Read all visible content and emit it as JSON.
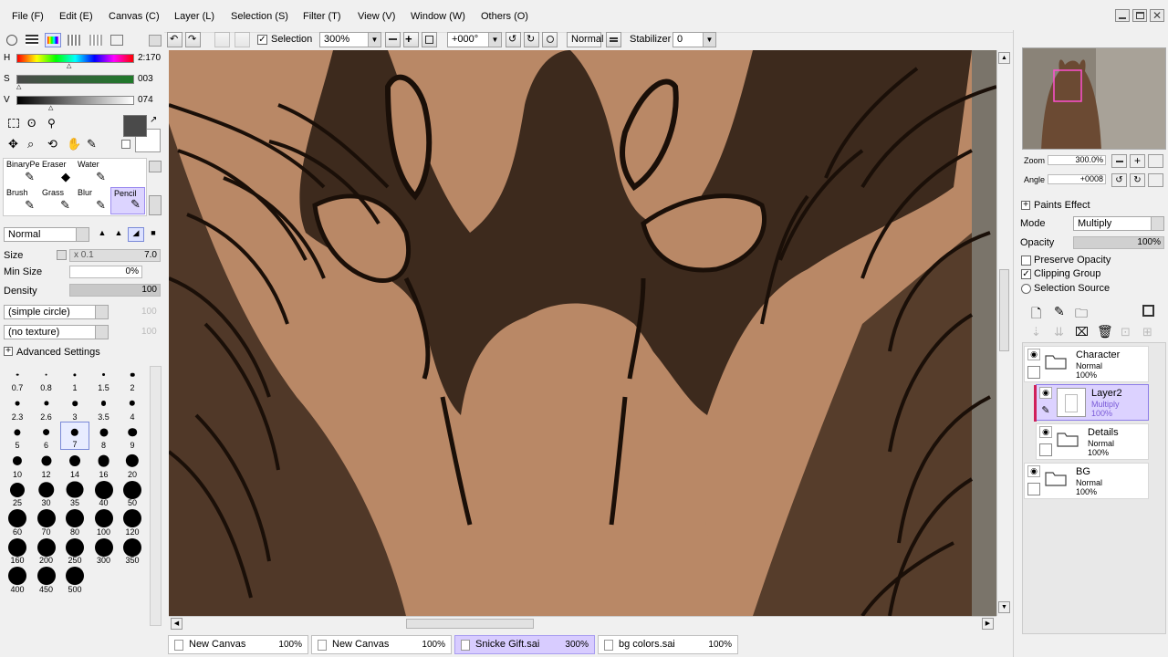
{
  "menu": [
    "File (F)",
    "Edit (E)",
    "Canvas (C)",
    "Layer (L)",
    "Selection (S)",
    "Filter (T)",
    "View (V)",
    "Window (W)",
    "Others (O)"
  ],
  "toolbar": {
    "selection_label": "Selection",
    "zoom_value": "300%",
    "rotation_value": "+000°",
    "blend_value": "Normal",
    "stabilizer_label": "Stabilizer",
    "stabilizer_value": "0"
  },
  "color": {
    "h_label": "H",
    "h_value": "2:170",
    "s_label": "S",
    "s_value": "003",
    "v_label": "V",
    "v_value": "074",
    "primary": "#4a4a4a",
    "secondary": "#ffffff"
  },
  "tools": [
    {
      "label": "BinaryPe",
      "glyph": "✎",
      "selected": false
    },
    {
      "label": "Eraser",
      "glyph": "◆",
      "selected": false
    },
    {
      "label": "Water",
      "glyph": "✎",
      "selected": false
    },
    {
      "label": "",
      "glyph": "",
      "selected": false
    },
    {
      "label": "Brush",
      "glyph": "✎",
      "selected": false
    },
    {
      "label": "Grass",
      "glyph": "✎",
      "selected": false
    },
    {
      "label": "Blur",
      "glyph": "✎",
      "selected": false
    },
    {
      "label": "Pencil",
      "glyph": "✎",
      "selected": true
    }
  ],
  "brush": {
    "blend": "Normal",
    "size_label": "Size",
    "size_mult": "x 0.1",
    "size_value": "7.0",
    "minsize_label": "Min Size",
    "minsize_value": "0%",
    "density_label": "Density",
    "density_value": "100",
    "shape": "(simple circle)",
    "shape_value": "100",
    "texture": "(no texture)",
    "texture_value": "100",
    "advanced_label": "Advanced Settings"
  },
  "brush_sizes": [
    "0.7",
    "0.8",
    "1",
    "1.5",
    "2",
    "2.3",
    "2.6",
    "3",
    "3.5",
    "4",
    "5",
    "6",
    "7",
    "8",
    "9",
    "10",
    "12",
    "14",
    "16",
    "20",
    "25",
    "30",
    "35",
    "40",
    "50",
    "60",
    "70",
    "80",
    "100",
    "120",
    "160",
    "200",
    "250",
    "300",
    "350",
    "400",
    "450",
    "500"
  ],
  "brush_size_selected": "7",
  "navigator": {
    "zoom_label": "Zoom",
    "zoom_value": "300.0%",
    "angle_label": "Angle",
    "angle_value": "+0008"
  },
  "layer_props": {
    "effect_label": "Paints Effect",
    "mode_label": "Mode",
    "mode_value": "Multiply",
    "opacity_label": "Opacity",
    "opacity_value": "100%",
    "preserve_label": "Preserve Opacity",
    "preserve_checked": false,
    "clipping_label": "Clipping Group",
    "clipping_checked": true,
    "selsource_label": "Selection Source"
  },
  "layers": [
    {
      "name": "Character",
      "mode": "Normal",
      "opacity": "100%",
      "type": "folder",
      "selected": false
    },
    {
      "name": "Layer2",
      "mode": "Multiply",
      "opacity": "100%",
      "type": "layer",
      "selected": true
    },
    {
      "name": "Details",
      "mode": "Normal",
      "opacity": "100%",
      "type": "folder",
      "selected": false
    },
    {
      "name": "BG",
      "mode": "Normal",
      "opacity": "100%",
      "type": "folder",
      "selected": false
    }
  ],
  "tabs": [
    {
      "name": "New Canvas",
      "percent": "100%",
      "active": false
    },
    {
      "name": "New Canvas",
      "percent": "100%",
      "active": false
    },
    {
      "name": "Snicke Gift.sai",
      "percent": "300%",
      "active": true
    },
    {
      "name": "bg colors.sai",
      "percent": "100%",
      "active": false
    }
  ],
  "colors": {
    "canvas_base": "#b98866",
    "canvas_dark": "#3d2a1d",
    "canvas_line": "#1a0f08",
    "selection_accent": "#dcd2ff"
  }
}
